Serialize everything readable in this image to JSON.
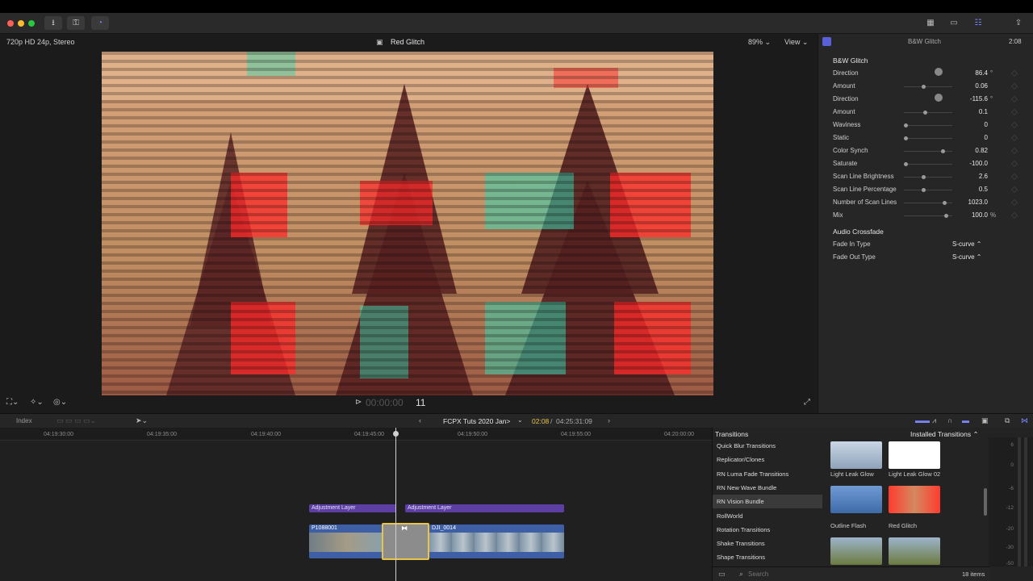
{
  "colors": {
    "accent": "#7b86ff",
    "selection": "#e8c547",
    "adjustment_layer": "#5d3fa3",
    "clip_bar": "#3e5fa6"
  },
  "toolbar": {
    "left_icons": [
      "import-icon",
      "keyword-icon",
      "background-tasks-icon"
    ],
    "right_icons": [
      "browser-layout-icon",
      "timeline-layout-icon",
      "inspector-icon",
      "share-icon"
    ]
  },
  "viewer": {
    "format": "720p HD 24p, Stereo",
    "clip_title": "Red Glitch",
    "zoom": "89%",
    "view_label": "View",
    "timecode_dim": "00:00:00",
    "timecode_frames": "11"
  },
  "inspector": {
    "title": "B&W Glitch",
    "header_time": "2:08",
    "effect_section": "B&W Glitch",
    "params": [
      {
        "label": "Direction",
        "value": "86.4",
        "unit": "°",
        "control": "dial"
      },
      {
        "label": "Amount",
        "value": "0.06",
        "unit": "",
        "control": "slider",
        "level": 0.4
      },
      {
        "label": "Direction",
        "value": "-115.6",
        "unit": "°",
        "control": "dial"
      },
      {
        "label": "Amount",
        "value": "0.1",
        "unit": "",
        "control": "slider",
        "level": 0.42
      },
      {
        "label": "Waviness",
        "value": "0",
        "unit": "",
        "control": "slider",
        "level": 0.0
      },
      {
        "label": "Static",
        "value": "0",
        "unit": "",
        "control": "slider",
        "level": 0.0
      },
      {
        "label": "Color Synch",
        "value": "0.82",
        "unit": "",
        "control": "slider",
        "level": 0.82
      },
      {
        "label": "Saturate",
        "value": "-100.0",
        "unit": "",
        "control": "slider",
        "level": 0.0
      },
      {
        "label": "Scan Line Brightness",
        "value": "2.6",
        "unit": "",
        "control": "slider",
        "level": 0.4
      },
      {
        "label": "Scan Line Percentage",
        "value": "0.5",
        "unit": "",
        "control": "slider",
        "level": 0.4
      },
      {
        "label": "Number of Scan Lines",
        "value": "1023.0",
        "unit": "",
        "control": "slider",
        "level": 0.85
      },
      {
        "label": "Mix",
        "value": "100.0",
        "unit": "%",
        "control": "slider",
        "level": 0.9
      }
    ],
    "audio_section": "Audio Crossfade",
    "audio_params": [
      {
        "label": "Fade In Type",
        "value": "S-curve"
      },
      {
        "label": "Fade Out Type",
        "value": "S-curve"
      }
    ]
  },
  "timeline_toolbar": {
    "index_label": "Index",
    "project_name": "FCPX Tuts 2020 Jan>",
    "time_current": "02:08",
    "time_total": "04:25:31:09"
  },
  "timeline": {
    "ruler_ticks": [
      "04:19:30:00",
      "04:19:35:00",
      "04:19:40:00",
      "04:19:45:00",
      "04:19:50:00",
      "04:19:55:00",
      "04:20:00:00"
    ],
    "adjustment_layers": [
      "Adjustment Layer",
      "Adjustment Layer"
    ],
    "clips": [
      "P1088001",
      "DJI_0014"
    ]
  },
  "browser": {
    "title": "Transitions",
    "filter": "Installed Transitions",
    "categories": [
      "Quick Blur Transitions",
      "Replicator/Clones",
      "RN Luma Fade Transitions",
      "RN New Wave Bundle",
      "RN Vision Bundle",
      "RollWorld",
      "Rotation Transitions",
      "Shake Transitions",
      "Shape Transitions"
    ],
    "selected_category": "RN Vision Bundle",
    "items": [
      "Light Leak Glow",
      "Light Leak Glow 02",
      "Outline Flash",
      "Red Glitch"
    ],
    "search_placeholder": "Search",
    "count": "18 items"
  },
  "meter": {
    "labels": [
      "6",
      "0",
      "-6",
      "-12",
      "-20",
      "-30",
      "-50"
    ]
  }
}
